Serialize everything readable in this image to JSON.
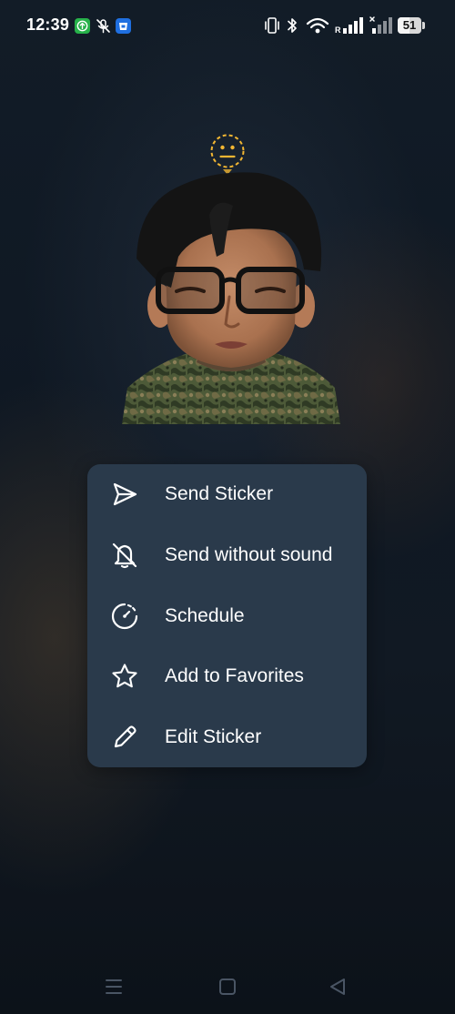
{
  "status_bar": {
    "time": "12:39",
    "battery_level": "51",
    "battery_fraction": 0.51,
    "notification_icons": [
      "upload-app-icon",
      "mic-muted-icon",
      "blue-app-icon"
    ],
    "system_icons": [
      "vibrate-icon",
      "bluetooth-icon",
      "wifi-icon",
      "signal-r-icon",
      "signal-x-icon",
      "battery-icon"
    ]
  },
  "sticker": {
    "emoji": "neutral-face-emoji",
    "image": "sticker-image"
  },
  "menu": {
    "items": [
      {
        "label": "Send Sticker",
        "icon": "send-icon"
      },
      {
        "label": "Send without sound",
        "icon": "bell-off-icon"
      },
      {
        "label": "Schedule",
        "icon": "schedule-icon"
      },
      {
        "label": "Add to Favorites",
        "icon": "star-icon"
      },
      {
        "label": "Edit Sticker",
        "icon": "pencil-icon"
      }
    ]
  },
  "navigation_bar": {
    "buttons": [
      "menu-icon",
      "home-icon",
      "back-icon"
    ]
  },
  "colors": {
    "menu_background": "#2a3a4b",
    "emoji_ring": "#f2b632",
    "text": "#ffffff"
  }
}
